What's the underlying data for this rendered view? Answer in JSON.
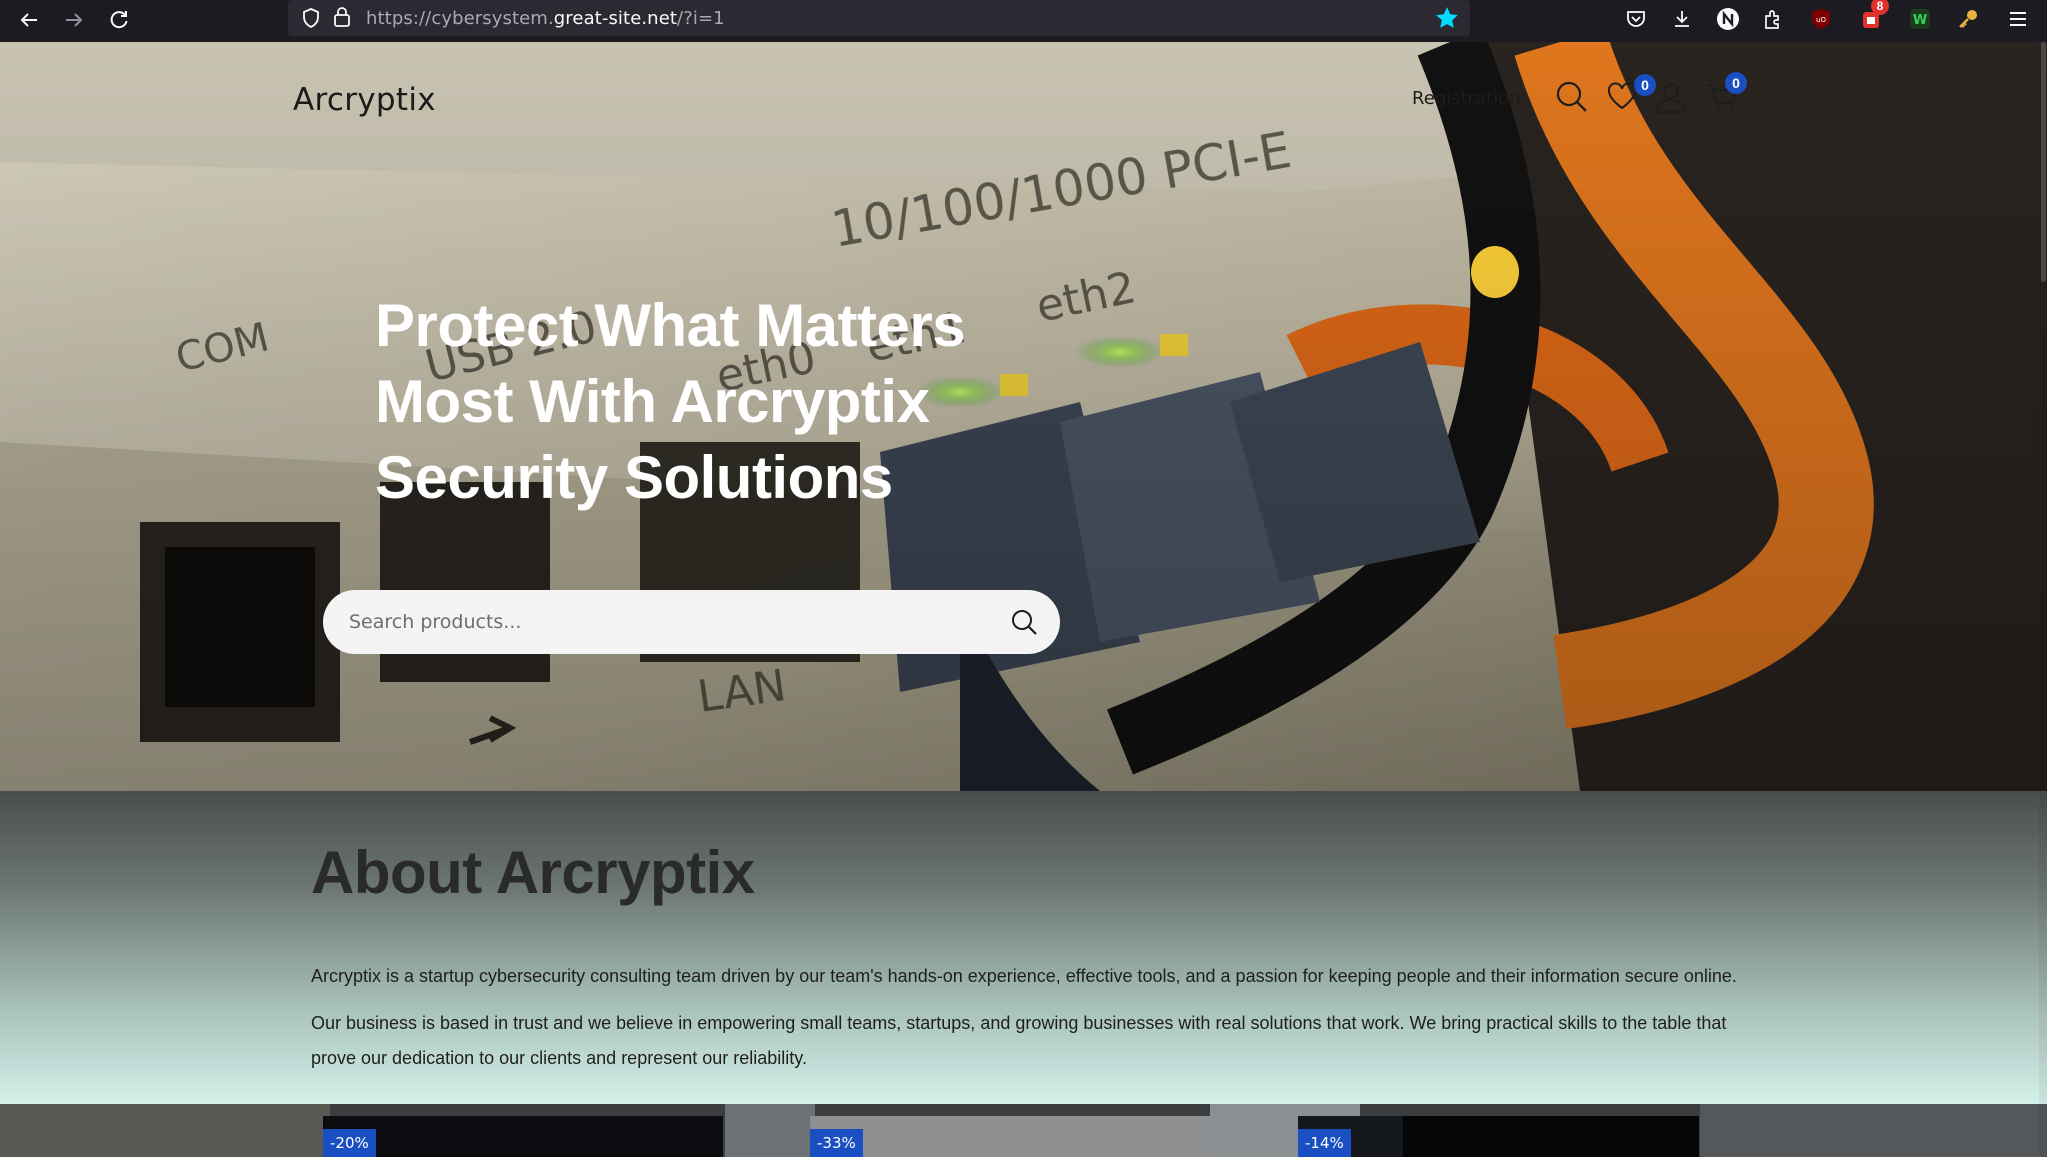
{
  "browser": {
    "url_prefix": "https://cybersystem.",
    "url_host": "great-site.net",
    "url_suffix": "/?i=1",
    "extension_badge": "8"
  },
  "header": {
    "logo": "Arcryptix",
    "registration": "Registration",
    "wishlist_count": "0",
    "cart_count": "0"
  },
  "hero": {
    "title_lines": [
      "Protect What Matters",
      "Most With Arcryptix",
      "Security Solutions"
    ],
    "search_placeholder": "Search products..."
  },
  "about": {
    "heading": "About Arcryptix",
    "paragraph1": "Arcryptix is a startup cybersecurity consulting team driven by our team's hands-on experience, effective tools, and a passion for keeping people and their information secure online.",
    "paragraph2": "Our business is based in trust and we believe in empowering small teams, startups, and growing businesses with real solutions that work. We bring practical skills to the table that prove our dedication to our clients and represent our reliability."
  },
  "products": {
    "discounts": [
      "-20%",
      "-33%",
      "-14%"
    ]
  },
  "colors": {
    "accent": "#1a4fc4",
    "browser_bg": "#1c1b22",
    "star": "#00ddff"
  }
}
